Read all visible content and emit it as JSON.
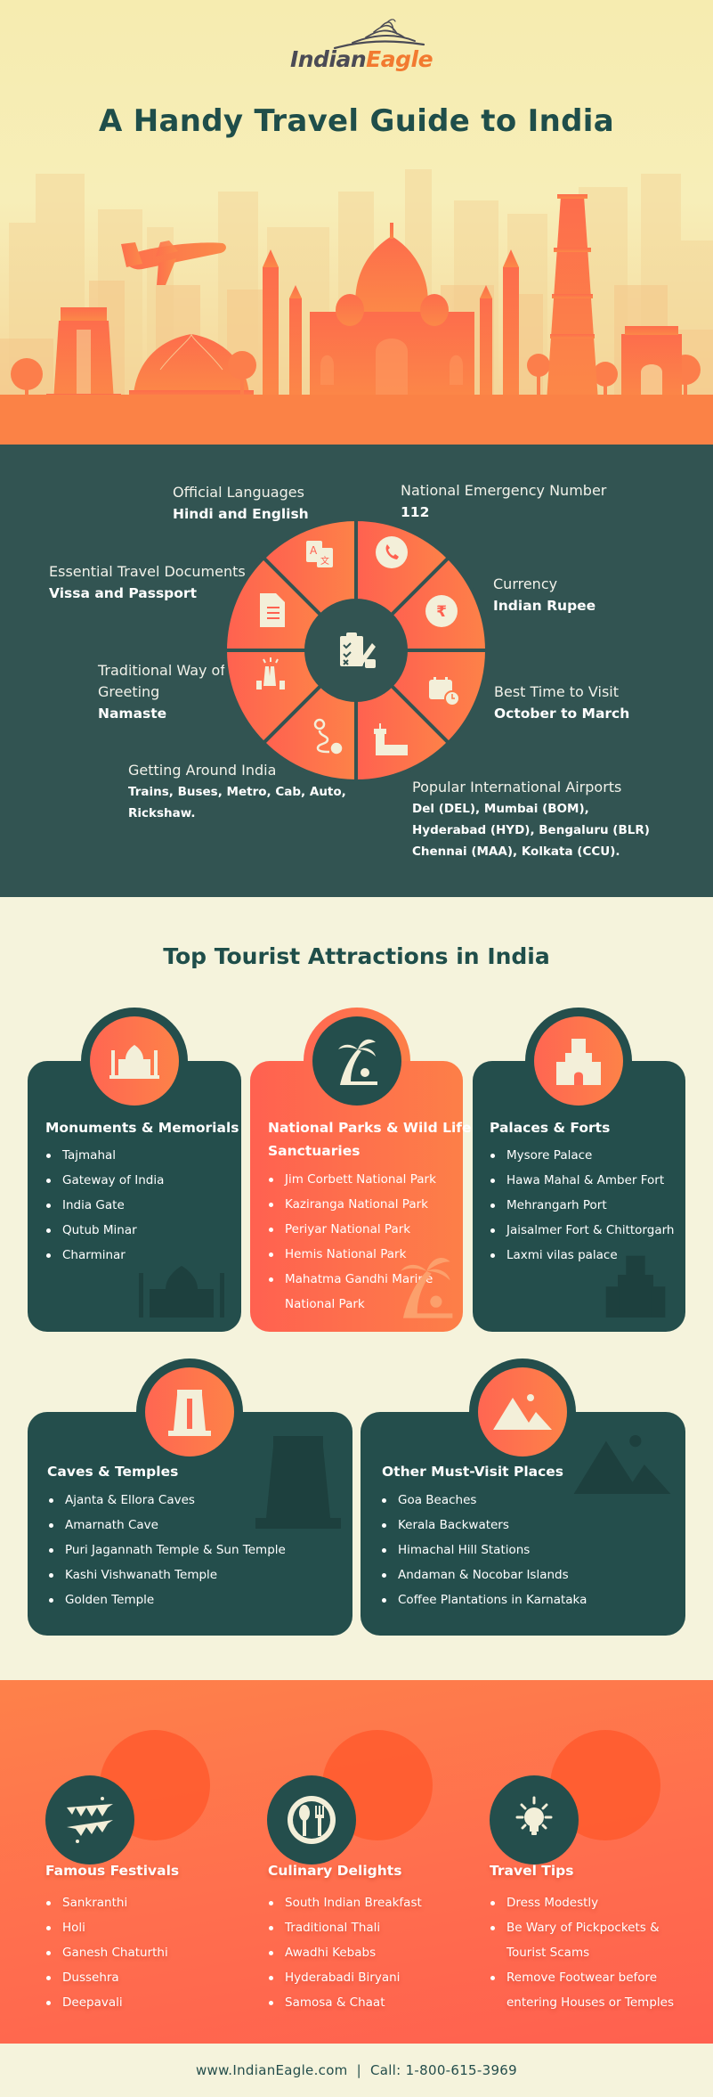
{
  "brand": {
    "name_part1": "Indian",
    "name_part2": "Eagle",
    "colors": {
      "dark_text": "#4b4b55",
      "accent": "#f27a30"
    }
  },
  "hero": {
    "title": "A Handy Travel Guide to India",
    "illustration": "india-landmarks-skyline"
  },
  "colors": {
    "teal": "#244e4c",
    "teal_section": "#325452",
    "orange": "#ff6150",
    "orange_light": "#fd7f48",
    "cream": "#f5f3dc",
    "cream_icon": "#f3efd9"
  },
  "info": {
    "center_icon": "checklist-icon",
    "items": [
      {
        "label": "Official Languages",
        "value": "Hindi and English",
        "icon": "translate-icon"
      },
      {
        "label": "National Emergency Number",
        "value": "112",
        "icon": "phone-icon"
      },
      {
        "label": "Currency",
        "value": "Indian Rupee",
        "icon": "rupee-icon"
      },
      {
        "label": "Best Time to Visit",
        "value": "October to March",
        "icon": "calendar-clock-icon"
      },
      {
        "label": "Popular International Airports",
        "value_lines": [
          "Del (DEL), Mumbai (BOM),",
          "Hyderabad (HYD), Bengaluru (BLR)",
          "Chennai (MAA), Kolkata (CCU)."
        ],
        "icon": "airport-icon"
      },
      {
        "label": "Getting Around India",
        "value_lines": [
          "Trains, Buses, Metro, Cab, Auto,",
          "Rickshaw."
        ],
        "icon": "route-icon"
      },
      {
        "label_lines": [
          "Traditional Way of",
          "Greeting"
        ],
        "value": "Namaste",
        "icon": "namaste-hands-icon"
      },
      {
        "label": "Essential Travel Documents",
        "value": "Vissa and Passport",
        "icon": "document-icon"
      }
    ]
  },
  "attractions": {
    "title": "Top Tourist Attractions in India",
    "cards": [
      {
        "title": "Monuments & Memorials",
        "icon": "taj-mahal-icon",
        "items": [
          "Tajmahal",
          "Gateway of India",
          "India Gate",
          "Qutub Minar",
          "Charminar"
        ]
      },
      {
        "title_lines": [
          "National Parks & Wild Life",
          "Sanctuaries"
        ],
        "icon": "palm-tree-icon",
        "items": [
          "Jim Corbett National Park",
          "Kaziranga National Park",
          "Periyar National Park",
          "Hemis National Park",
          "Mahatma Gandhi Marine"
        ],
        "item_continuation": "National Park"
      },
      {
        "title": "Palaces & Forts",
        "icon": "fort-icon",
        "items": [
          "Mysore Palace",
          "Hawa Mahal & Amber Fort",
          "Mehrangarh Port",
          "Jaisalmer Fort & Chittorgarh",
          "Laxmi vilas palace"
        ]
      },
      {
        "title": "Caves & Temples",
        "icon": "temple-gopuram-icon",
        "items": [
          "Ajanta & Ellora Caves",
          "Amarnath Cave",
          "Puri Jagannath Temple & Sun Temple",
          "Kashi Vishwanath Temple",
          "Golden Temple"
        ]
      },
      {
        "title": "Other Must-Visit Places",
        "icon": "mountains-icon",
        "items": [
          "Goa Beaches",
          "Kerala Backwaters",
          "Himachal Hill Stations",
          "Andaman & Nocobar Islands",
          "Coffee Plantations in Karnataka"
        ]
      }
    ]
  },
  "extras": [
    {
      "title": "Famous Festivals",
      "icon": "bunting-icon",
      "items": [
        "Sankranthi",
        "Holi",
        "Ganesh Chaturthi",
        "Dussehra",
        "Deepavali"
      ]
    },
    {
      "title": "Culinary Delights",
      "icon": "plate-cutlery-icon",
      "items": [
        "South Indian Breakfast",
        "Traditional Thali",
        "Awadhi Kebabs",
        "Hyderabadi Biryani",
        "Samosa & Chaat"
      ]
    },
    {
      "title": "Travel Tips",
      "icon": "lightbulb-icon",
      "items": [
        "Dress Modestly",
        "Be Wary of Pickpockets &",
        "Remove Footwear before"
      ],
      "continuations": {
        "1": "Tourist Scams",
        "2": "entering Houses or Temples"
      }
    }
  ],
  "footer": {
    "website": "www.IndianEagle.com",
    "separator": "|",
    "phone": "Call: 1-800-615-3969"
  }
}
